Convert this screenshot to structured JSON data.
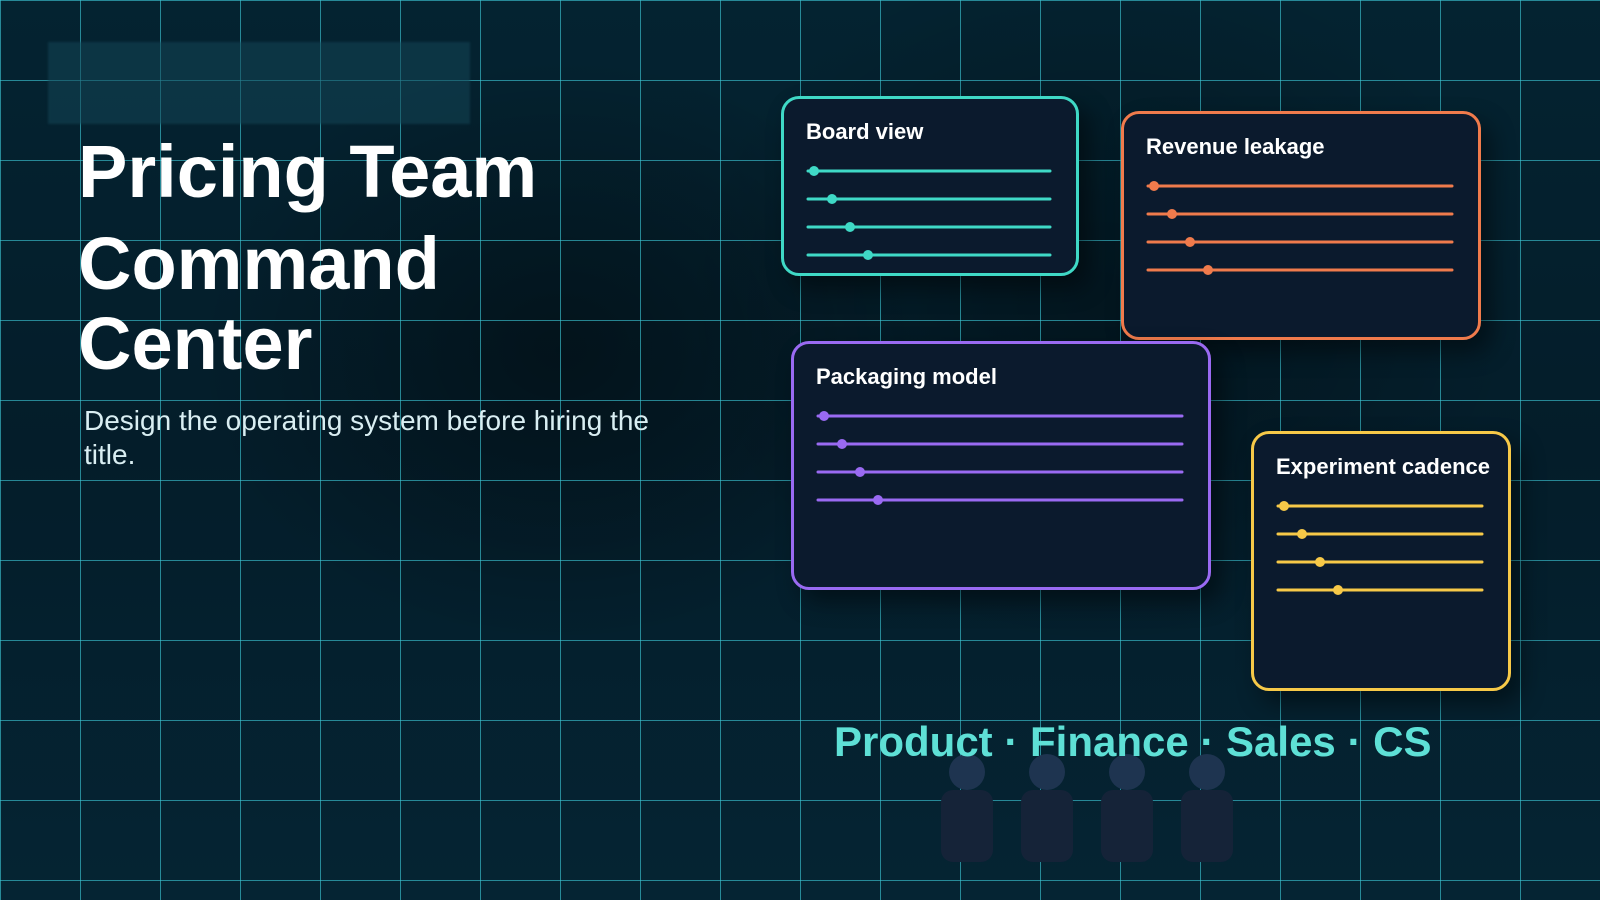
{
  "slide": {
    "title_line1": "Pricing Team",
    "title_line2": "Command",
    "title_line3": "Center",
    "subtitle": "Design the operating system before hiring the title.",
    "teams_label": "Product · Finance · Sales · CS"
  },
  "colors": {
    "background": "#05222f",
    "grid": "#3cc8d7",
    "teal": "#3fd9c6",
    "orange": "#f07b4c",
    "purple": "#9a6af2",
    "yellow": "#f7c948",
    "team_label": "#5ee0d6"
  },
  "cards": [
    {
      "title": "Board view",
      "color": "#3fd9c6"
    },
    {
      "title": "Revenue leakage",
      "color": "#f07b4c"
    },
    {
      "title": "Packaging model",
      "color": "#9a6af2"
    },
    {
      "title": "Experiment cadence",
      "color": "#f7c948"
    }
  ],
  "people_count": 4
}
